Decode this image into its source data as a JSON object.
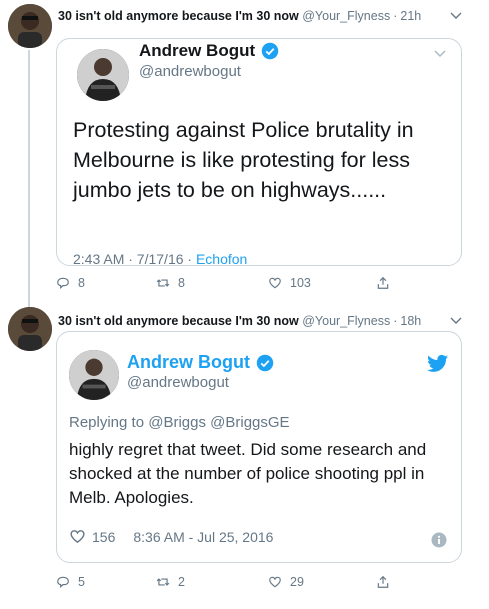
{
  "tweets": [
    {
      "author": {
        "name": "30 isn't old anymore because I'm 30 now",
        "handle": "@Your_Flyness",
        "time": "21h"
      },
      "quoted": {
        "name": "Andrew Bogut",
        "handle": "@andrewbogut",
        "verified": true,
        "text": "Protesting against Police brutality in Melbourne is like protesting for less jumbo jets to be on highways......",
        "timestamp": "2:43 AM · 7/17/16 · ",
        "source": "Echofon"
      },
      "actions": {
        "replies": "8",
        "retweets": "8",
        "likes": "103"
      }
    },
    {
      "author": {
        "name": "30 isn't old anymore because I'm 30 now",
        "handle": "@Your_Flyness",
        "time": "18h"
      },
      "quoted": {
        "name": "Andrew Bogut",
        "handle": "@andrewbogut",
        "verified": true,
        "replying_prefix": "Replying to ",
        "replying_to": "@Briggs @BriggsGE",
        "text": "highly regret that tweet. Did some research and shocked at the number of police shooting ppl in Melb. Apologies.",
        "likes": "156",
        "timestamp": "8:36 AM - Jul 25, 2016"
      },
      "actions": {
        "replies": "5",
        "retweets": "2",
        "likes": "29"
      }
    }
  ],
  "icons": {
    "reply": "reply-icon",
    "retweet": "retweet-icon",
    "like": "heart-icon",
    "share": "share-icon",
    "verified": "verified-badge-icon",
    "caret": "chevron-down-icon",
    "bird": "twitter-bird-icon",
    "info": "info-icon"
  },
  "colors": {
    "accent": "#1da1f2",
    "text": "#14171a",
    "muted": "#657786",
    "border": "#ccd6dd"
  }
}
